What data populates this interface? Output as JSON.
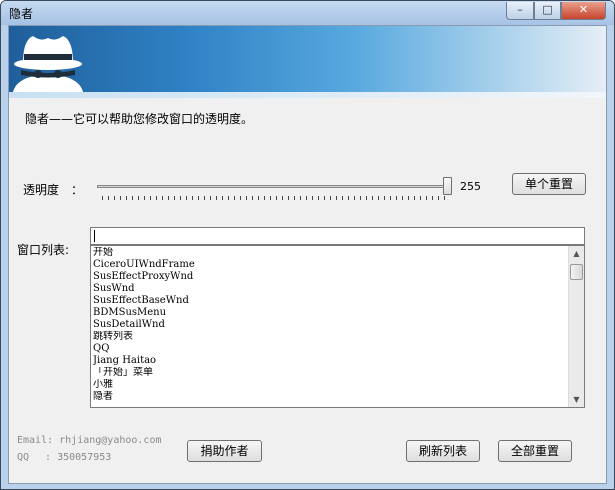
{
  "window": {
    "title": "隐者",
    "minimize": "–",
    "maximize": "□",
    "close": "✕"
  },
  "description": "隐者——它可以帮助您修改窗口的透明度。",
  "transparency": {
    "label": "透明度　：",
    "value": "255",
    "value_fraction": 1.0
  },
  "buttons": {
    "reset_single": "单个重置",
    "donate": "捐助作者",
    "refresh_list": "刷新列表",
    "reset_all": "全部重置"
  },
  "window_list": {
    "label": "窗口列表:",
    "filter_value": "",
    "items": [
      "开始",
      "CiceroUIWndFrame",
      "SusEffectProxyWnd",
      "SusWnd",
      "SusEffectBaseWnd",
      "BDMSusMenu",
      "SusDetailWnd",
      "跳转列表",
      "QQ",
      "Jiang Haitao",
      "「开始」菜单",
      "小雅",
      "隐者"
    ]
  },
  "footer": {
    "email": "Email: rhjiang@yahoo.com",
    "qq": "QQ　 : 350057953"
  },
  "icons": {
    "logo": "spy-hat-icon",
    "scroll_up": "chevron-up-icon",
    "scroll_down": "chevron-down-icon"
  },
  "colors": {
    "banner_dark": "#1f5e9a",
    "banner_light": "#58a9df"
  }
}
